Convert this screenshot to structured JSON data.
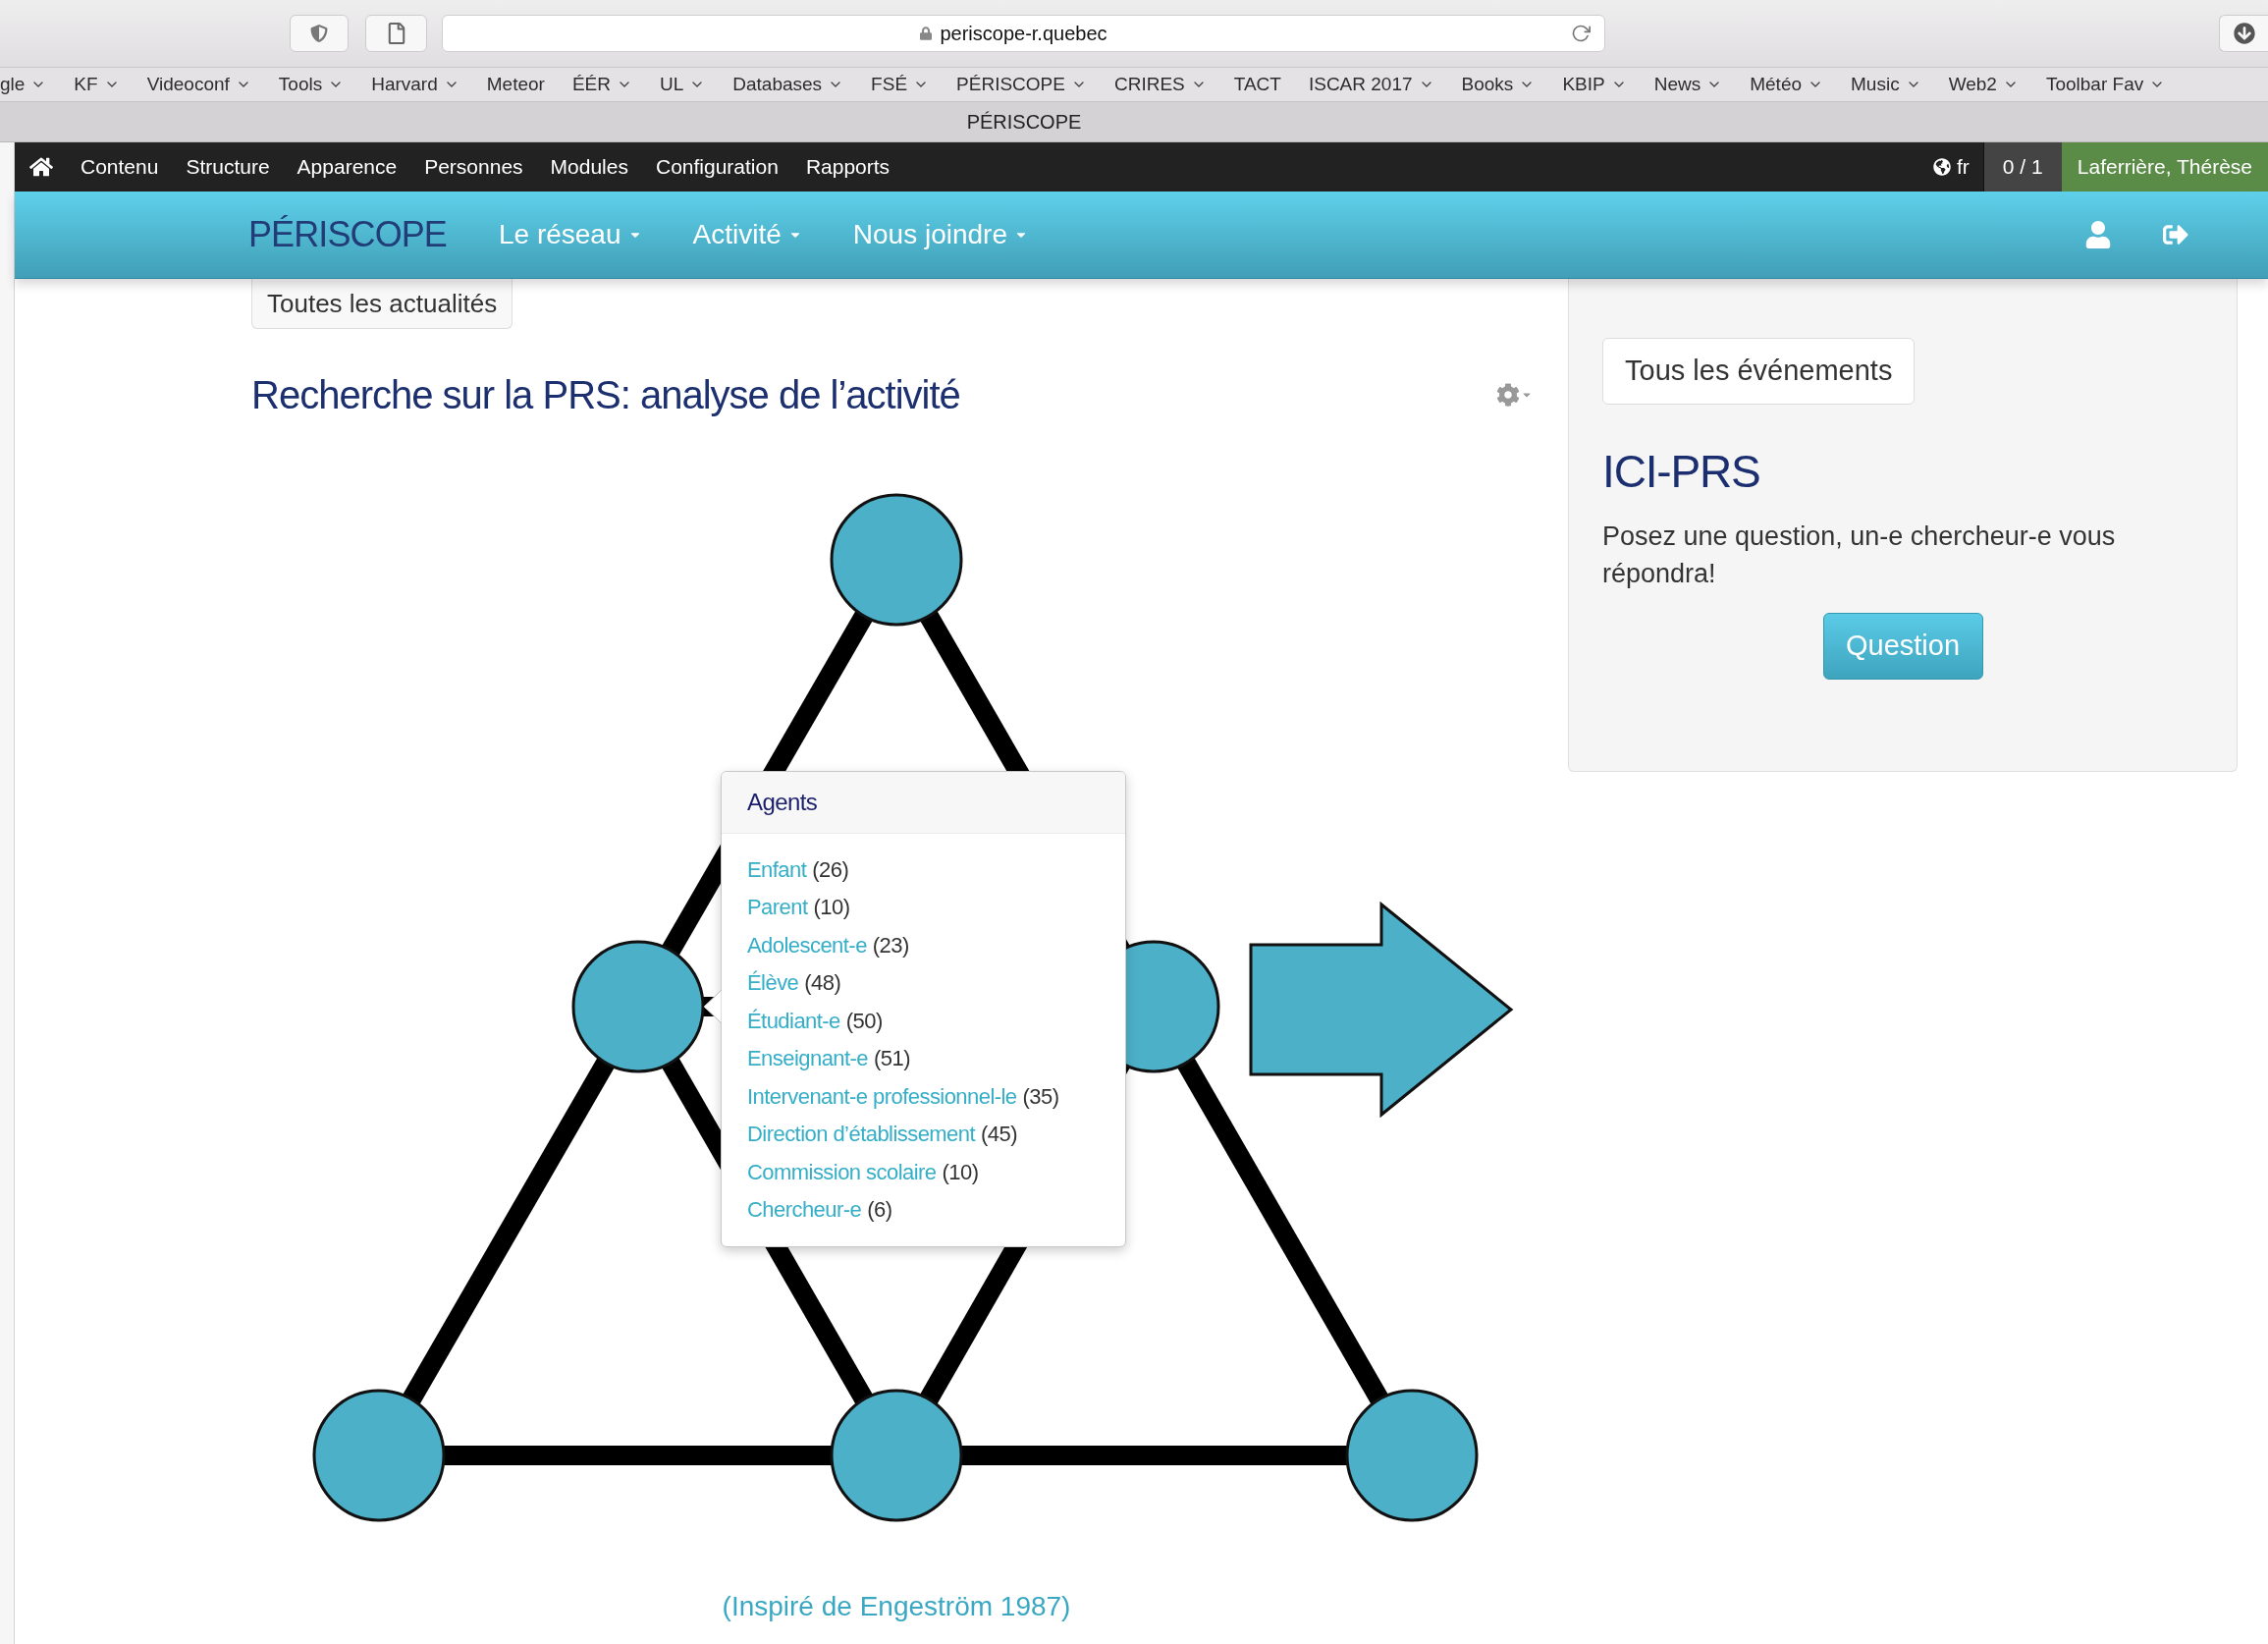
{
  "browser": {
    "address": "periscope-r.quebec",
    "tab_title": "PÉRISCOPE",
    "bookmarks": [
      {
        "label": "gle",
        "dropdown": true
      },
      {
        "label": "KF",
        "dropdown": true
      },
      {
        "label": "Videoconf",
        "dropdown": true
      },
      {
        "label": "Tools",
        "dropdown": true
      },
      {
        "label": "Harvard",
        "dropdown": true
      },
      {
        "label": "Meteor",
        "dropdown": false
      },
      {
        "label": "ÉÉR",
        "dropdown": true
      },
      {
        "label": "UL",
        "dropdown": true
      },
      {
        "label": "Databases",
        "dropdown": true
      },
      {
        "label": "FSÉ",
        "dropdown": true
      },
      {
        "label": "PÉRISCOPE",
        "dropdown": true
      },
      {
        "label": "CRIRES",
        "dropdown": true
      },
      {
        "label": "TACT",
        "dropdown": false
      },
      {
        "label": "ISCAR 2017",
        "dropdown": true
      },
      {
        "label": "Books",
        "dropdown": true
      },
      {
        "label": "KBIP",
        "dropdown": true
      },
      {
        "label": "News",
        "dropdown": true
      },
      {
        "label": "Météo",
        "dropdown": true
      },
      {
        "label": "Music",
        "dropdown": true
      },
      {
        "label": "Web2",
        "dropdown": true
      },
      {
        "label": "Toolbar Fav",
        "dropdown": true
      }
    ]
  },
  "admin_toolbar": {
    "items": [
      "Contenu",
      "Structure",
      "Apparence",
      "Personnes",
      "Modules",
      "Configuration",
      "Rapports"
    ],
    "language": "fr",
    "counter": "0 / 1",
    "user": "Laferrière, Thérèse"
  },
  "navbar": {
    "logo": "PÉRISCOPE",
    "items": [
      "Le réseau",
      "Activité",
      "Nous joindre"
    ]
  },
  "main": {
    "news_button": "Toutes les actualités",
    "title": "Recherche sur la PRS: analyse de l’activité",
    "popover": {
      "title": "Agents",
      "items": [
        {
          "label": "Enfant",
          "count": "(26)"
        },
        {
          "label": "Parent",
          "count": "(10)"
        },
        {
          "label": "Adolescent-e",
          "count": "(23)"
        },
        {
          "label": "Élève",
          "count": "(48)"
        },
        {
          "label": "Étudiant-e",
          "count": "(50)"
        },
        {
          "label": "Enseignant-e",
          "count": "(51)"
        },
        {
          "label": "Intervenant-e professionnel-le",
          "count": "(35)"
        },
        {
          "label": "Direction d’établissement",
          "count": "(45)"
        },
        {
          "label": "Commission scolaire",
          "count": "(10)"
        },
        {
          "label": "Chercheur-e",
          "count": "(6)"
        }
      ]
    },
    "caption": "(Inspiré de Engeström 1987)"
  },
  "sidebar": {
    "events_button": "Tous les événements",
    "heading": "ICI-PRS",
    "text": "Posez une question, un-e chercheur-e vous répondra!",
    "button": "Question"
  }
}
